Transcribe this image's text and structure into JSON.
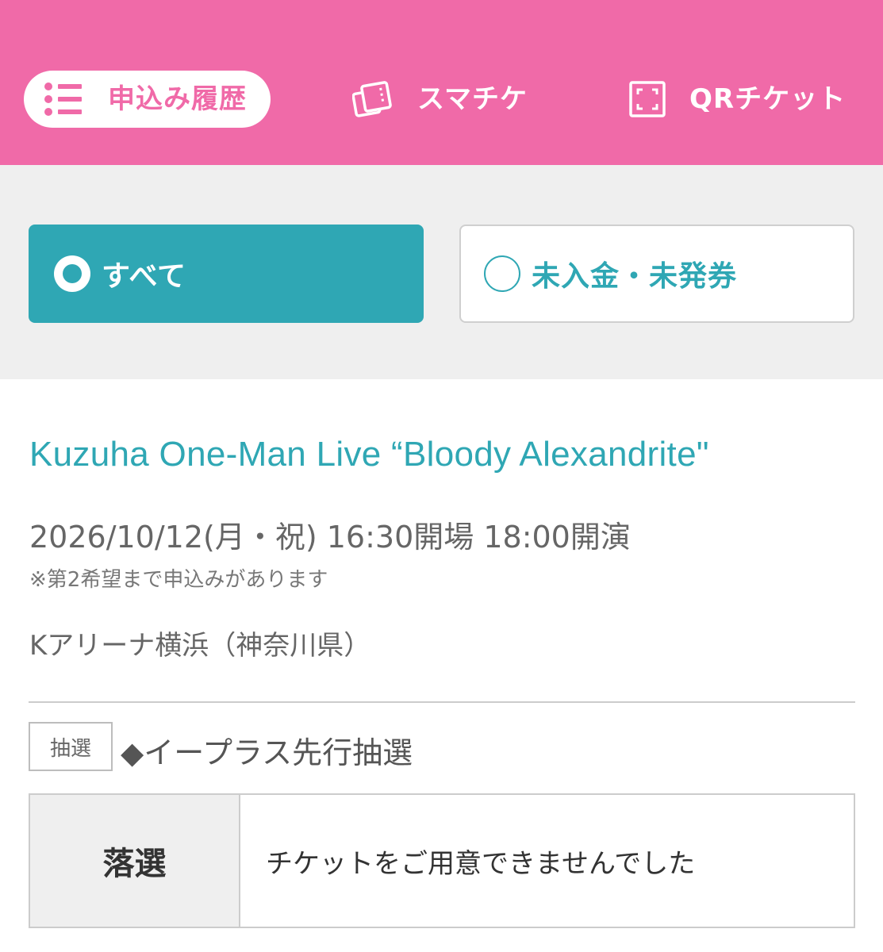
{
  "nav": {
    "tabs": [
      {
        "label": "申込み履歴",
        "icon": "list-icon",
        "active": true
      },
      {
        "label": "スマチケ",
        "icon": "ticket-icon",
        "active": false
      },
      {
        "label": "QRチケット",
        "icon": "qr-scan-icon",
        "active": false
      }
    ],
    "colors": {
      "brand": "#f06aa8",
      "accent": "#2fa7b4"
    }
  },
  "filter": {
    "options": [
      {
        "label": "すべて",
        "selected": true
      },
      {
        "label": "未入金・未発券",
        "selected": false
      }
    ]
  },
  "event": {
    "title": "Kuzuha One-Man Live “Bloody Alexandrite\"",
    "datetime": "2026/10/12(月・祝) 16:30開場 18:00開演",
    "note": "※第2希望まで申込みがあります",
    "venue": "Kアリーナ横浜（神奈川県）"
  },
  "lottery": {
    "badge": "抽選",
    "name": "◆イープラス先行抽選",
    "result_status": "落選",
    "result_message": "チケットをご用意できませんでした"
  }
}
